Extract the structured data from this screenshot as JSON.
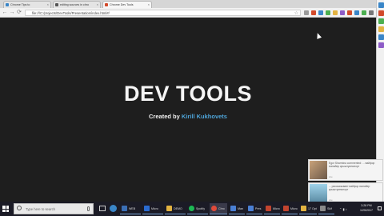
{
  "browser": {
    "tabs": [
      {
        "label": "Chrome Tips to",
        "active": false,
        "favicon_color": "#3a86c8"
      },
      {
        "label": "editing sources in chro",
        "active": false,
        "favicon_color": "#555555"
      },
      {
        "label": "Chrome Dev Tools",
        "active": true,
        "favicon_color": "#d24a2b"
      }
    ],
    "url": "file:///C:/projects/DevTools/Presentation/index.html#/",
    "back_label": "←",
    "forward_label": "→",
    "reload_label": "⟳"
  },
  "slide": {
    "title": "DEV TOOLS",
    "byline_prefix": "Created by ",
    "author": "Kirill Kukhovets"
  },
  "notifications": [
    {
      "text": "Egor Sharmina commented: ... вайфор юзнайер крыштумпопорт",
      "meta": "site"
    },
    {
      "text": "... рассказывает вайфор юзнайер крыштумпопорт",
      "meta": "site"
    }
  ],
  "taskbar": {
    "search_placeholder": "Type here to search",
    "apps": [
      {
        "label": "WEB",
        "icon_color": "#3b6fb6"
      },
      {
        "label": "Micro",
        "icon_color": "#2a6bd1"
      },
      {
        "label": "DEMO",
        "icon_color": "#e3b341"
      },
      {
        "label": "Spotify",
        "icon_color": "#1db954"
      },
      {
        "label": "Chro",
        "icon_color": "#e04a3a",
        "active": true
      },
      {
        "label": "Man",
        "icon_color": "#4a7fd4"
      },
      {
        "label": "Pres",
        "icon_color": "#4a7fd4"
      },
      {
        "label": "Micro",
        "icon_color": "#c2442f"
      },
      {
        "label": "Micro",
        "icon_color": "#c2442f"
      },
      {
        "label": "17 Opt",
        "icon_color": "#e3b341"
      },
      {
        "label": "Skif",
        "icon_color": "#8a8a8a"
      }
    ],
    "clock_time": "3:28 PM",
    "clock_date": "1/25/2017"
  }
}
